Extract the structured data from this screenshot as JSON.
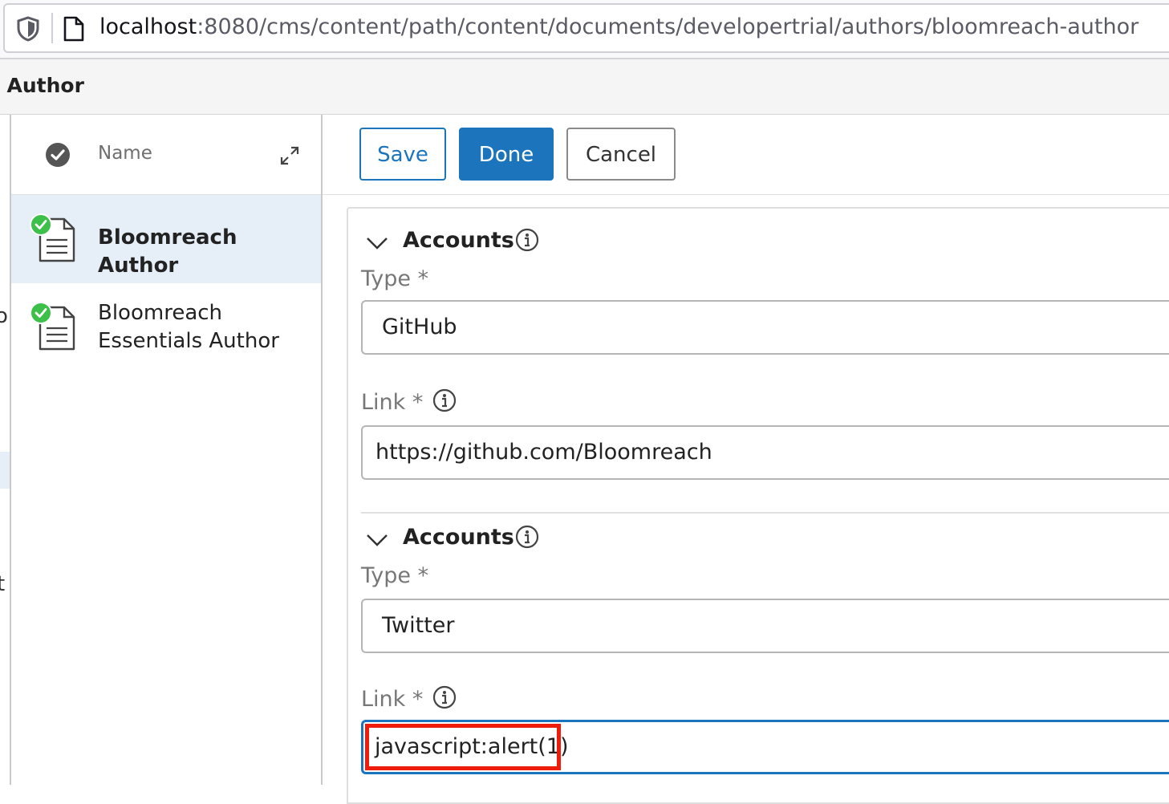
{
  "browser": {
    "url_host": "localhost",
    "url_rest": ":8080/cms/content/path/content/documents/developertrial/authors/bloomreach-author"
  },
  "header": {
    "title": "h Author"
  },
  "left_stub": {
    "char1": "o",
    "char2": "t"
  },
  "doc_list": {
    "column_name": "Name",
    "items": [
      {
        "name": "Bloomreach Author",
        "selected": true,
        "status": "published"
      },
      {
        "name_line1": "Bloomreach",
        "name_line2": "Essentials Author",
        "selected": false,
        "status": "published"
      }
    ]
  },
  "toolbar": {
    "save_label": "Save",
    "done_label": "Done",
    "cancel_label": "Cancel"
  },
  "accounts": [
    {
      "title": "Accounts",
      "type_label": "Type *",
      "type_value": "GitHub",
      "link_label": "Link *",
      "link_value": "https://github.com/Bloomreach"
    },
    {
      "title": "Accounts",
      "type_label": "Type *",
      "type_value": "Twitter",
      "link_label": "Link *",
      "link_value": "javascript:alert(1)"
    }
  ],
  "colors": {
    "accent": "#1c75bc",
    "selection": "#e6eef7",
    "status_green": "#3cc04a",
    "highlight_red": "#ee1c08"
  },
  "icons": [
    "shield-icon",
    "page-icon",
    "check-circle-icon",
    "expand-icon",
    "document-icon",
    "chevron-down-icon",
    "info-icon"
  ]
}
